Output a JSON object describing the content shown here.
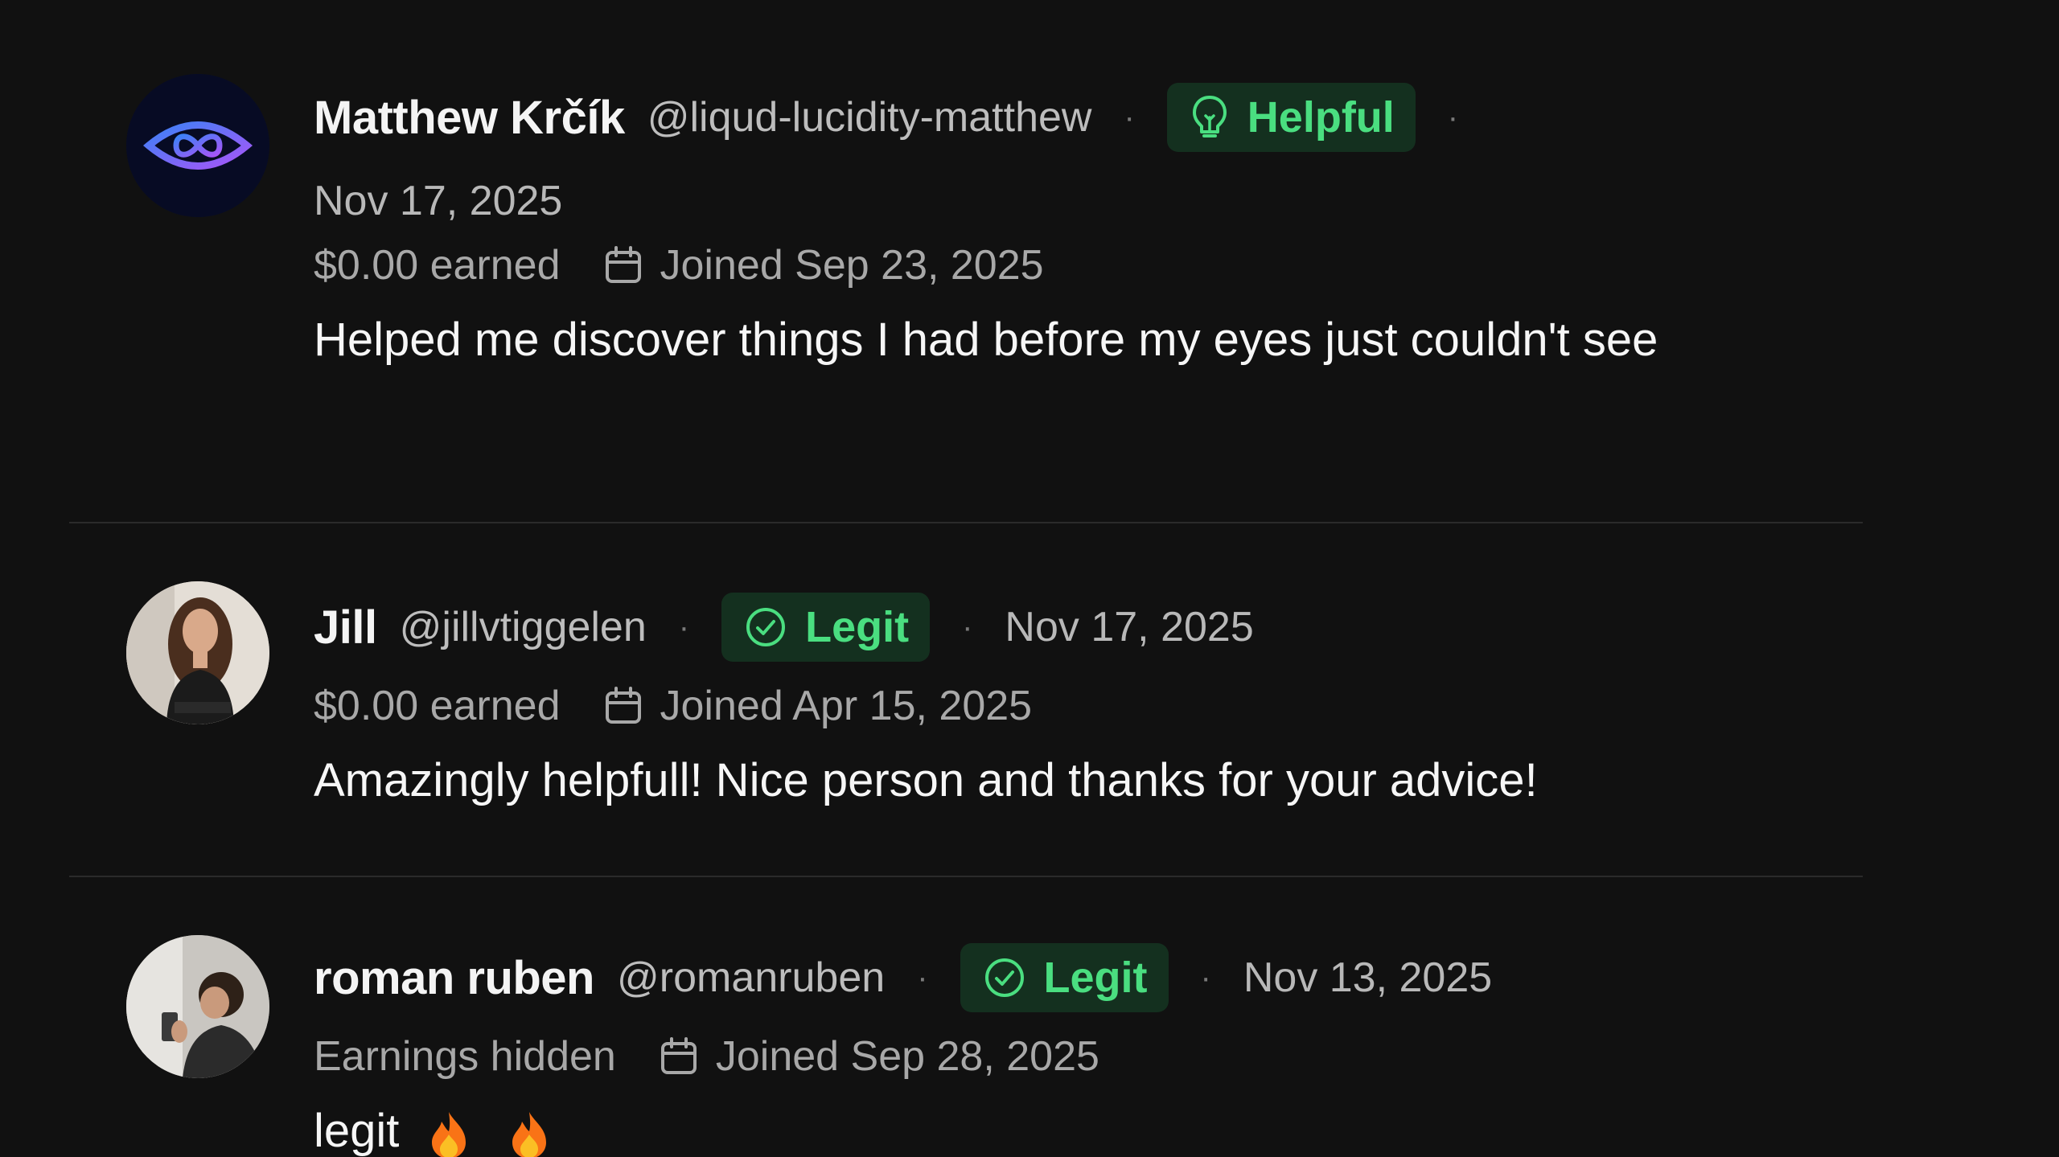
{
  "reviews": [
    {
      "name": "Matthew Krčík",
      "handle": "@liqud-lucidity-matthew",
      "badge": {
        "label": "Helpful",
        "icon": "lightbulb-icon"
      },
      "date": "Nov 17, 2025",
      "earnings": "$0.00 earned",
      "joined": "Joined Sep 23, 2025",
      "text": "Helped me discover things I had before my eyes just couldn't see"
    },
    {
      "name": "Jill",
      "handle": "@jillvtiggelen",
      "badge": {
        "label": "Legit",
        "icon": "check-circle-icon"
      },
      "date": "Nov 17, 2025",
      "earnings": "$0.00 earned",
      "joined": "Joined Apr 15, 2025",
      "text": "Amazingly helpfull! Nice person and thanks for your advice!"
    },
    {
      "name": "roman ruben",
      "handle": "@romanruben",
      "badge": {
        "label": "Legit",
        "icon": "check-circle-icon"
      },
      "date": "Nov 13, 2025",
      "earnings": "Earnings hidden",
      "joined": "Joined Sep 28, 2025",
      "text": "legit"
    }
  ],
  "colors": {
    "background": "#111111",
    "badge_bg": "#14301f",
    "badge_text": "#4ade80",
    "divider": "#2b2b2b"
  }
}
